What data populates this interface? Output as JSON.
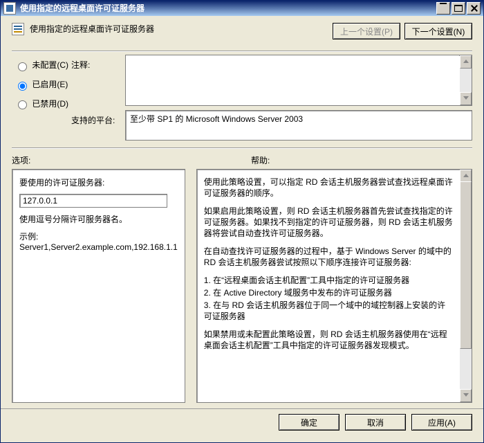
{
  "window": {
    "title": "使用指定的远程桌面许可证服务器"
  },
  "header": {
    "subtitle": "使用指定的远程桌面许可证服务器",
    "prev_button": "上一个设置(P)",
    "next_button": "下一个设置(N)"
  },
  "config": {
    "radio_notconfigured": "未配置(C)",
    "radio_enabled": "已启用(E)",
    "radio_disabled": "已禁用(D)",
    "comment_label": "注释:",
    "comment_value": "",
    "platform_label": "支持的平台:",
    "platform_value": "至少带 SP1 的 Microsoft Windows Server 2003"
  },
  "panel_labels": {
    "options": "选项:",
    "help": "帮助:"
  },
  "options": {
    "servers_label": "要使用的许可证服务器:",
    "servers_value": "127.0.0.1",
    "hint1": "使用逗号分隔许可服务器名。",
    "hint2": "示例: Server1,Server2.example.com,192.168.1.1"
  },
  "help": {
    "p1": "使用此策略设置，可以指定 RD 会话主机服务器尝试查找远程桌面许可证服务器的顺序。",
    "p2": "如果启用此策略设置，则 RD 会话主机服务器首先尝试查找指定的许可证服务器。如果找不到指定的许可证服务器，则 RD 会话主机服务器将尝试自动查找许可证服务器。",
    "p3": "在自动查找许可证服务器的过程中，基于 Windows Server 的域中的 RD 会话主机服务器尝试按照以下顺序连接许可证服务器:",
    "l1": "1. 在“远程桌面会话主机配置”工具中指定的许可证服务器",
    "l2": "2. 在 Active Directory 域服务中发布的许可证服务器",
    "l3": "3. 在与 RD 会话主机服务器位于同一个域中的域控制器上安装的许可证服务器",
    "p4": "如果禁用或未配置此策略设置，则 RD 会话主机服务器使用在“远程桌面会话主机配置”工具中指定的许可证服务器发现模式。"
  },
  "buttons": {
    "ok": "确定",
    "cancel": "取消",
    "apply": "应用(A)"
  }
}
